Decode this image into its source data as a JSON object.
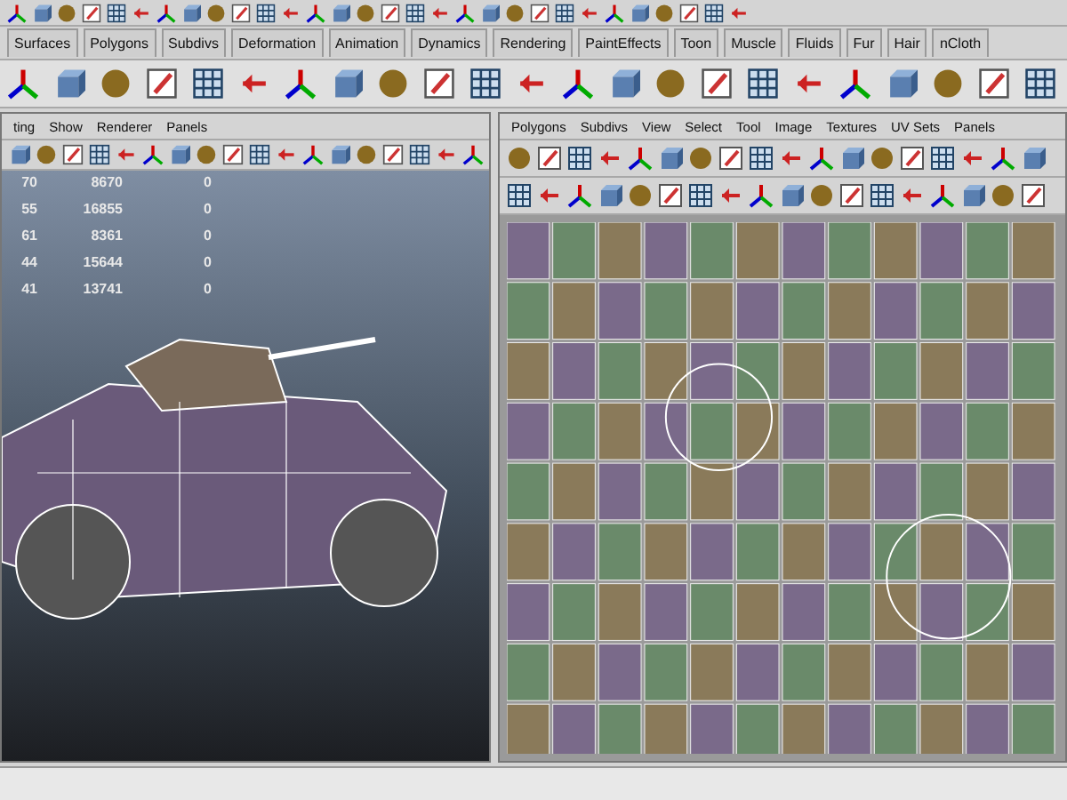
{
  "shelf_tabs": [
    {
      "label": "Surfaces",
      "selected": false
    },
    {
      "label": "Polygons",
      "selected": false
    },
    {
      "label": "Subdivs",
      "selected": false
    },
    {
      "label": "Deformation",
      "selected": false
    },
    {
      "label": "Animation",
      "selected": false
    },
    {
      "label": "Dynamics",
      "selected": false
    },
    {
      "label": "Rendering",
      "selected": false
    },
    {
      "label": "PaintEffects",
      "selected": false
    },
    {
      "label": "Toon",
      "selected": false
    },
    {
      "label": "Muscle",
      "selected": false
    },
    {
      "label": "Fluids",
      "selected": false
    },
    {
      "label": "Fur",
      "selected": false
    },
    {
      "label": "Hair",
      "selected": false
    },
    {
      "label": "nCloth",
      "selected": false
    }
  ],
  "viewport_panel": {
    "menu": [
      "ting",
      "Show",
      "Renderer",
      "Panels"
    ],
    "stats": [
      [
        "70",
        "8670",
        "0"
      ],
      [
        "55",
        "16855",
        "0"
      ],
      [
        "61",
        "8361",
        "0"
      ],
      [
        "44",
        "15644",
        "0"
      ],
      [
        "41",
        "13741",
        "0"
      ]
    ]
  },
  "uv_editor_panel": {
    "menu": [
      "Polygons",
      "Subdivs",
      "View",
      "Select",
      "Tool",
      "Image",
      "Textures",
      "UV Sets",
      "Panels"
    ]
  }
}
